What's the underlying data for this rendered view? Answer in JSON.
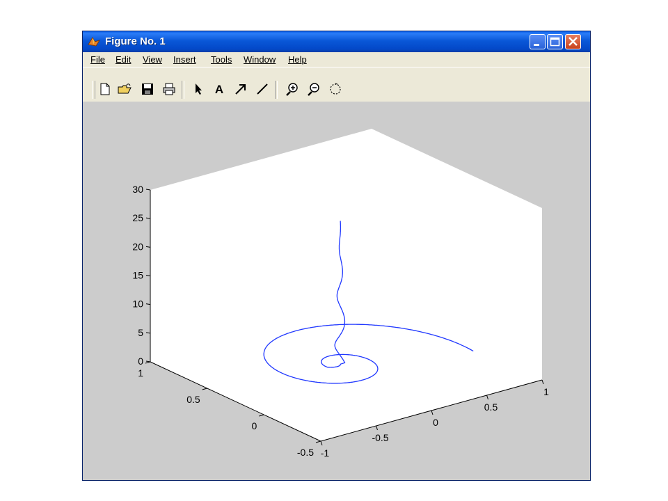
{
  "window": {
    "title": "Figure No. 1",
    "colors": {
      "titlebar": "#0a58d8",
      "canvas": "#cccccc",
      "axes": "#ffffff",
      "line": "#2038ff"
    }
  },
  "title_buttons": [
    {
      "name": "minimize-button",
      "icon": "minimize-icon"
    },
    {
      "name": "maximize-button",
      "icon": "maximize-icon"
    },
    {
      "name": "close-button",
      "icon": "close-icon"
    }
  ],
  "menu": [
    "File",
    "Edit",
    "View",
    "Insert",
    "Tools",
    "Window",
    "Help"
  ],
  "toolbar": {
    "tools": [
      "new-file-icon",
      "open-folder-icon",
      "save-icon",
      "print-icon",
      "arrow-select-icon",
      "insert-text-icon",
      "insert-arrow-icon",
      "insert-line-icon",
      "zoom-in-icon",
      "zoom-out-icon",
      "rotate-3d-icon"
    ],
    "text_tool_label": "A"
  },
  "chart_data": {
    "type": "line",
    "title": "",
    "xlabel": "",
    "ylabel": "",
    "zlabel": "",
    "xlim": [
      -1,
      1
    ],
    "ylim": [
      -0.5,
      1
    ],
    "zlim": [
      0,
      30
    ],
    "x_ticks": [
      "-1",
      "-0.5",
      "0",
      "0.5",
      "1"
    ],
    "y_ticks": [
      "-0.5",
      "0",
      "0.5",
      "1"
    ],
    "z_ticks": [
      "0",
      "5",
      "10",
      "15",
      "20",
      "25",
      "30"
    ],
    "grid": false,
    "series": [
      {
        "description": "3-D spiral decaying toward the centre then rising vertically",
        "x_start": 0.85,
        "y_start": 0.1,
        "z_start": 0,
        "z_end": 25
      }
    ]
  }
}
